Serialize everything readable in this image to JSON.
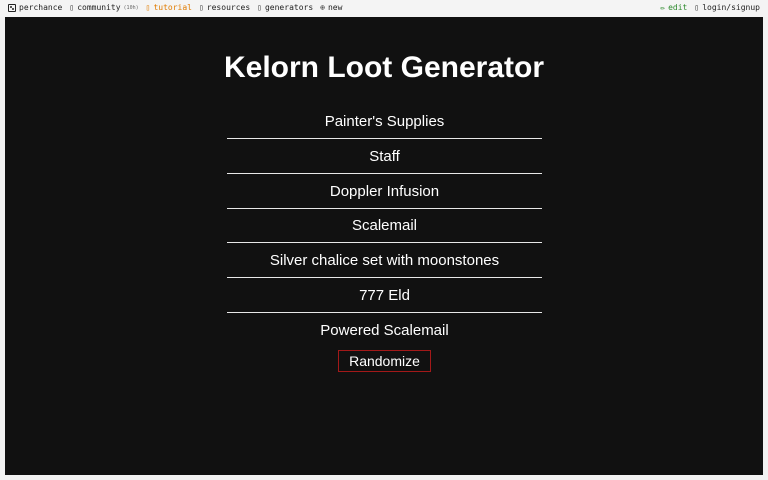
{
  "nav": {
    "brand": "perchance",
    "community": "community",
    "community_count": "(10h)",
    "tutorial": "tutorial",
    "resources": "resources",
    "generators": "generators",
    "new": "new",
    "edit": "edit",
    "login": "login/signup",
    "tutorial_color": "#e07b00",
    "edit_color": "#2e8b2e"
  },
  "generator": {
    "title": "Kelorn Loot Generator",
    "items": [
      "Painter's Supplies",
      "Staff",
      "Doppler Infusion",
      "Scalemail",
      "Silver chalice set with moonstones",
      "777 Eld",
      "Powered Scalemail"
    ],
    "button_label": "Randomize",
    "button_border_color": "#a31919",
    "background_color": "#111111"
  }
}
